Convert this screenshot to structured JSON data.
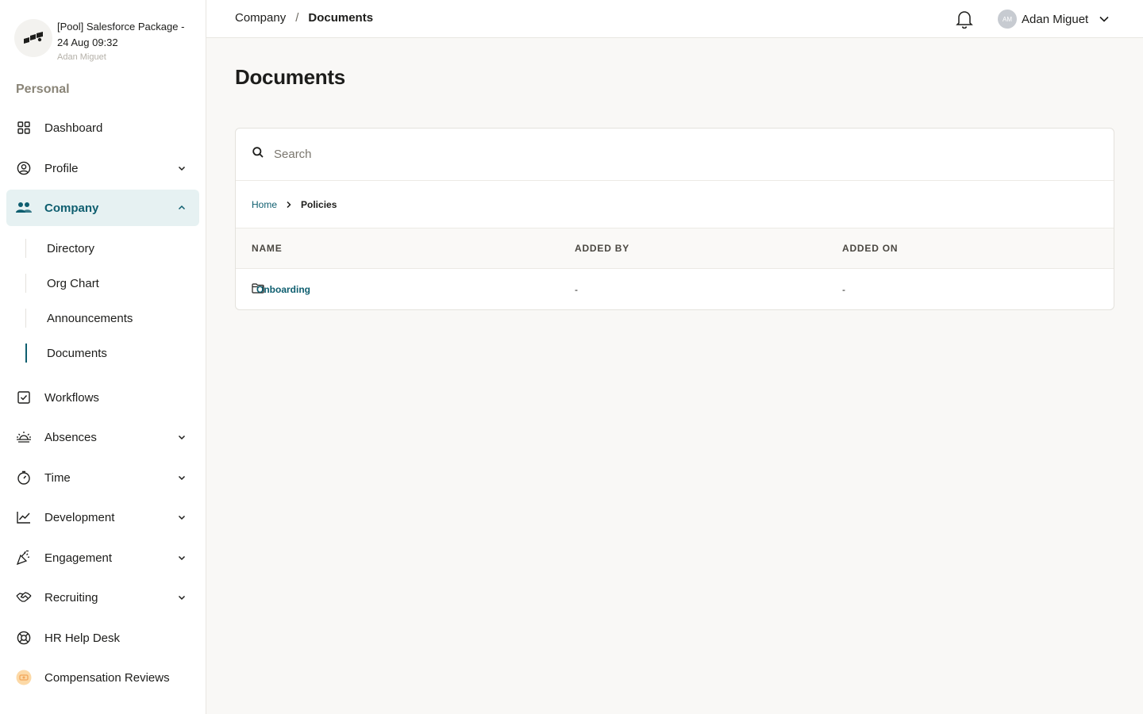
{
  "org": {
    "name_line1": "[Pool] Salesforce Package -",
    "name_line2": "24 Aug 09:32",
    "user": "Adan Miguet"
  },
  "sidebar": {
    "section_label": "Personal",
    "items": [
      {
        "label": "Dashboard"
      },
      {
        "label": "Profile"
      },
      {
        "label": "Company"
      },
      {
        "label": "Workflows"
      },
      {
        "label": "Absences"
      },
      {
        "label": "Time"
      },
      {
        "label": "Development"
      },
      {
        "label": "Engagement"
      },
      {
        "label": "Recruiting"
      },
      {
        "label": "HR Help Desk"
      },
      {
        "label": "Compensation Reviews"
      }
    ],
    "company_subitems": [
      {
        "label": "Directory"
      },
      {
        "label": "Org Chart"
      },
      {
        "label": "Announcements"
      },
      {
        "label": "Documents"
      }
    ]
  },
  "topbar": {
    "breadcrumb": [
      "Company",
      "Documents"
    ],
    "separator": "/",
    "user_initials": "AM",
    "user_name": "Adan Miguet"
  },
  "main": {
    "title": "Documents",
    "search_placeholder": "Search",
    "path": {
      "home": "Home",
      "current": "Policies"
    },
    "columns": [
      "NAME",
      "ADDED BY",
      "ADDED ON"
    ],
    "rows": [
      {
        "name": "Onboarding",
        "added_by": "-",
        "added_on": "-",
        "icon": "folder-icon"
      }
    ]
  },
  "colors": {
    "accent": "#0e5e6f",
    "active_bg": "#e6f1f2",
    "page_bg": "#f9f8f6"
  }
}
